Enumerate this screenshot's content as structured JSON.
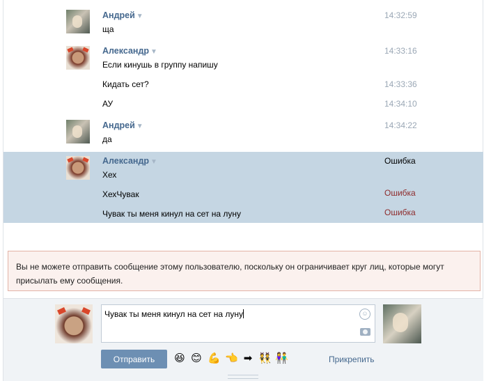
{
  "messages": [
    {
      "author": "Андрей",
      "text": "ща",
      "time": "14:32:59"
    },
    {
      "author": "Александр",
      "text": "Если кинушь в группу напишу",
      "time": "14:33:16"
    },
    {
      "text": "Кидать сет?",
      "time": "14:33:36"
    },
    {
      "text": "АУ",
      "time": "14:34:10"
    },
    {
      "author": "Андрей",
      "text": "да",
      "time": "14:34:22"
    },
    {
      "author": "Александр",
      "text": "Хех",
      "status": "Ошибка"
    },
    {
      "text": "ХехЧувак",
      "status": "Ошибка"
    },
    {
      "text": "Чувак ты меня кинул на сет на луну",
      "status": "Ошибка"
    }
  ],
  "author_menu_glyph": "▼",
  "notice": "Вы не можете отправить сообщение этому пользователю, поскольку он ограничивает круг лиц, которые могут присылать ему сообщения.",
  "composer": {
    "value": "Чувак ты меня кинул на сет на луну",
    "send_label": "Отправить",
    "attach_label": "Прикрепить",
    "smile_glyph": "☺",
    "emoji": [
      "😆",
      "😊",
      "💪",
      "👈",
      "➡",
      "👯",
      "👫"
    ]
  },
  "colors": {
    "accent": "#45688e",
    "selected_bg": "#c5d6e3",
    "error_text": "#8e2b2b",
    "notice_bg": "#fbf1ee",
    "notice_border": "#e3b3a6",
    "button": "#6d8fb3"
  }
}
